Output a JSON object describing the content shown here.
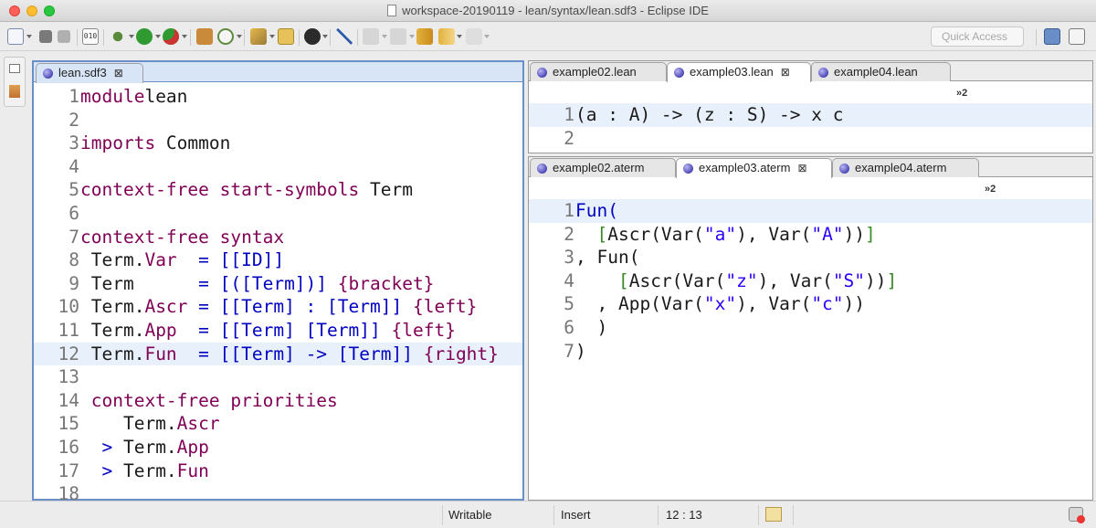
{
  "window": {
    "title": "workspace-20190119 - lean/syntax/lean.sdf3 - Eclipse IDE"
  },
  "toolbar": {
    "quick_access_placeholder": "Quick Access",
    "zoom_badge": "010"
  },
  "left_editor": {
    "tab_label": "lean.sdf3",
    "lines": [
      {
        "n": "1",
        "segs": [
          [
            "kw",
            "module"
          ],
          [
            "",
            "lean"
          ]
        ]
      },
      {
        "n": "2",
        "segs": []
      },
      {
        "n": "3",
        "segs": [
          [
            "kw",
            "imports"
          ],
          [
            "",
            " Common"
          ]
        ]
      },
      {
        "n": "4",
        "segs": []
      },
      {
        "n": "5",
        "segs": [
          [
            "kw",
            "context-free start-symbols"
          ],
          [
            "",
            " Term"
          ]
        ]
      },
      {
        "n": "6",
        "segs": []
      },
      {
        "n": "7",
        "segs": [
          [
            "kw",
            "context-free syntax"
          ]
        ]
      },
      {
        "n": "8",
        "segs": [
          [
            "",
            " Term."
          ],
          [
            "cons",
            "Var"
          ],
          [
            "",
            " "
          ],
          [
            "sym",
            " = [[ID]]"
          ]
        ]
      },
      {
        "n": "9",
        "segs": [
          [
            "",
            " Term"
          ],
          [
            "sym",
            "      = [([Term])] "
          ],
          [
            "kw",
            "{bracket}"
          ]
        ]
      },
      {
        "n": "10",
        "segs": [
          [
            "",
            " Term."
          ],
          [
            "cons",
            "Ascr"
          ],
          [
            "sym",
            " = [[Term] : [Term]] "
          ],
          [
            "kw",
            "{left}"
          ]
        ]
      },
      {
        "n": "11",
        "segs": [
          [
            "",
            " Term."
          ],
          [
            "cons",
            "App"
          ],
          [
            "sym",
            "  = [[Term] [Term]] "
          ],
          [
            "kw",
            "{left}"
          ]
        ]
      },
      {
        "n": "12",
        "segs": [
          [
            "",
            " Term."
          ],
          [
            "cons",
            "Fun"
          ],
          [
            "",
            "  "
          ],
          [
            "sym",
            "= [[Term] -> [Term]] "
          ],
          [
            "kw",
            "{right}"
          ]
        ]
      },
      {
        "n": "13",
        "segs": []
      },
      {
        "n": "14",
        "segs": [
          [
            "kw",
            " context-free priorities"
          ]
        ]
      },
      {
        "n": "15",
        "segs": [
          [
            "",
            "    Term."
          ],
          [
            "cons",
            "Ascr"
          ]
        ]
      },
      {
        "n": "16",
        "segs": [
          [
            "sym",
            "  > "
          ],
          [
            "",
            "Term."
          ],
          [
            "cons",
            "App"
          ]
        ]
      },
      {
        "n": "17",
        "segs": [
          [
            "sym",
            "  > "
          ],
          [
            "",
            "Term."
          ],
          [
            "cons",
            "Fun"
          ]
        ]
      },
      {
        "n": "18",
        "segs": []
      }
    ]
  },
  "lean_editor": {
    "tabs": [
      "example02.lean",
      "example03.lean",
      "example04.lean"
    ],
    "overflow": "»2",
    "lines": [
      {
        "n": "1",
        "segs": [
          [
            "",
            "(a : A) -> (z : S) -> x c"
          ]
        ]
      },
      {
        "n": "2",
        "segs": []
      }
    ]
  },
  "aterm_editor": {
    "tabs": [
      "example02.aterm",
      "example03.aterm",
      "example04.aterm"
    ],
    "overflow": "»2",
    "lines": [
      {
        "n": "1",
        "segs": [
          [
            "sym",
            "Fun("
          ]
        ]
      },
      {
        "n": "2",
        "segs": [
          [
            "",
            "  "
          ],
          [
            "gb",
            "["
          ],
          [
            "",
            "Ascr(Var("
          ],
          [
            "str",
            "\"a\""
          ],
          [
            "",
            "), Var("
          ],
          [
            "str",
            "\"A\""
          ],
          [
            "",
            "))"
          ],
          [
            "gb",
            "]"
          ]
        ]
      },
      {
        "n": "3",
        "segs": [
          [
            "",
            ", Fun("
          ]
        ]
      },
      {
        "n": "4",
        "segs": [
          [
            "",
            "    "
          ],
          [
            "gb",
            "["
          ],
          [
            "",
            "Ascr(Var("
          ],
          [
            "str",
            "\"z\""
          ],
          [
            "",
            "), Var("
          ],
          [
            "str",
            "\"S\""
          ],
          [
            "",
            "))"
          ],
          [
            "gb",
            "]"
          ]
        ]
      },
      {
        "n": "5",
        "segs": [
          [
            "",
            "  , App(Var("
          ],
          [
            "str",
            "\"x\""
          ],
          [
            "",
            "), Var("
          ],
          [
            "str",
            "\"c\""
          ],
          [
            "",
            "))"
          ]
        ]
      },
      {
        "n": "6",
        "segs": [
          [
            "",
            "  )"
          ]
        ]
      },
      {
        "n": "7",
        "segs": [
          [
            "",
            ")"
          ]
        ]
      }
    ]
  },
  "status": {
    "mode": "Writable",
    "insert": "Insert",
    "position": "12 : 13"
  },
  "colors": {
    "keyword": "#7f0055",
    "symbol": "#0000c0",
    "string": "#2a00ff",
    "bracket": "#3a8a26",
    "current_line": "#e8f0fb"
  }
}
